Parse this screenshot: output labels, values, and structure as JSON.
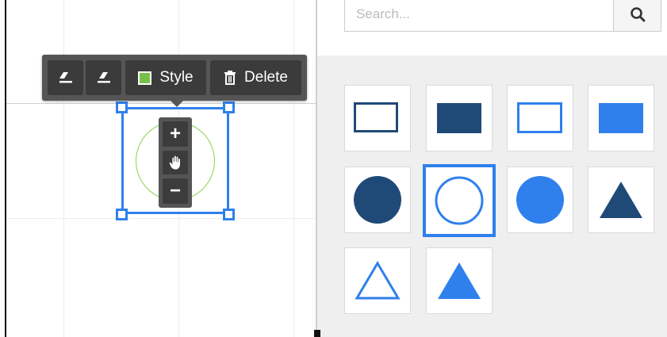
{
  "toolbar": {
    "style_label": "Style",
    "delete_label": "Delete",
    "style_swatch_color": "#78c04a",
    "icons": [
      "text-align-left-icon",
      "text-align-right-icon",
      "trash-icon"
    ]
  },
  "zoom_control": {
    "zoom_in_label": "+",
    "zoom_out_label": "−",
    "icons": [
      "pan-hand-icon"
    ]
  },
  "search": {
    "placeholder": "Search...",
    "value": "",
    "icon": "search-icon"
  },
  "shapes": [
    {
      "name": "rectangle-outline-dark",
      "selected": false
    },
    {
      "name": "rectangle-filled-dark",
      "selected": false
    },
    {
      "name": "rectangle-outline-blue",
      "selected": false
    },
    {
      "name": "rectangle-filled-blue",
      "selected": false
    },
    {
      "name": "circle-filled-dark",
      "selected": false
    },
    {
      "name": "circle-outline-blue",
      "selected": true
    },
    {
      "name": "circle-filled-blue",
      "selected": false
    },
    {
      "name": "triangle-filled-dark",
      "selected": false
    },
    {
      "name": "triangle-outline-blue",
      "selected": false
    },
    {
      "name": "triangle-filled-blue",
      "selected": false
    }
  ],
  "colors": {
    "dark_blue": "#1f4a78",
    "bright_blue": "#2f80ed",
    "selection_blue": "#2f80ed",
    "shape_stroke_green": "#8bd24a",
    "toolbar_bg": "#555555"
  }
}
